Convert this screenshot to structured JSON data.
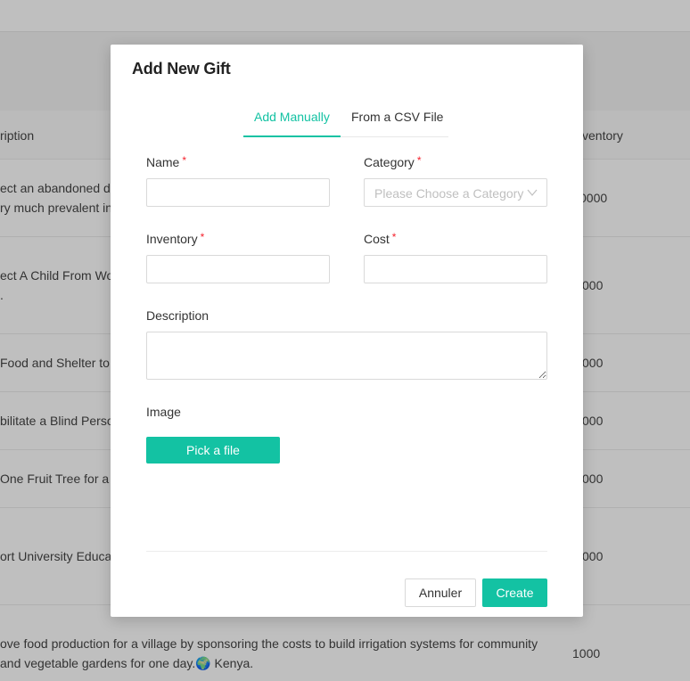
{
  "background": {
    "table": {
      "header": {
        "description": "ription",
        "inventory": "ventory"
      },
      "rows": [
        {
          "desc1": "ect an abandoned do",
          "desc2": "ry much prevalent in",
          "inventory": "0000"
        },
        {
          "desc1": "ect A Child From Wor",
          "desc2": ".",
          "inventory": "000"
        },
        {
          "desc1": "Food and Shelter to",
          "inventory": "000"
        },
        {
          "desc1": "bilitate a Blind Perso",
          "inventory": "000"
        },
        {
          "desc1": " One Fruit Tree for a",
          "inventory": "000"
        },
        {
          "desc1": "ort University Educa",
          "inventory": "000"
        },
        {
          "desc1": "ove food production for a village by sponsoring the costs to build irrigation systems for community",
          "desc2": "and vegetable gardens for one day.🌍 Kenya.",
          "inventory": "1000"
        }
      ]
    }
  },
  "modal": {
    "title": "Add New Gift",
    "tabs": [
      {
        "label": "Add Manually",
        "active": true
      },
      {
        "label": "From a CSV File",
        "active": false
      }
    ],
    "fields": {
      "name": {
        "label": "Name",
        "value": ""
      },
      "category": {
        "label": "Category",
        "placeholder": "Please Choose a Category"
      },
      "inventory": {
        "label": "Inventory",
        "value": ""
      },
      "cost": {
        "label": "Cost",
        "value": ""
      },
      "description": {
        "label": "Description",
        "value": ""
      },
      "image": {
        "label": "Image",
        "button": "Pick a file"
      }
    },
    "required_mark": "*",
    "footer": {
      "cancel": "Annuler",
      "create": "Create"
    }
  },
  "colors": {
    "accent": "#13c2a3",
    "required": "#f5222d",
    "overlay": "rgba(0,0,0,0.25)"
  }
}
